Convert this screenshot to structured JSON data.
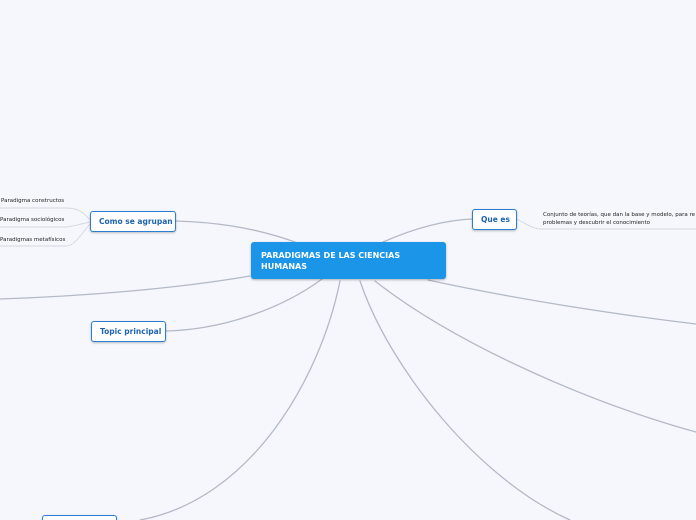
{
  "mindmap": {
    "central": {
      "line1": "PARADIGMAS DE LAS CIENCIAS",
      "line2": "HUMANAS"
    },
    "topics": {
      "como_se_agrupan": "Como se agrupan",
      "que_es": "Que es",
      "topic_principal": "Topic principal"
    },
    "subtopics": {
      "paradigma_constructos": "Paradigma constructos",
      "paradigma_sociologicos": "Paradigma sociológicos",
      "paradigmas_metafisicos": "Paradigmas metafísicos",
      "que_es_definicion_line1": "Conjunto de teorías,  que dan la base y modelo, para re",
      "que_es_definicion_line2": "problemas y descubrir el conocimiento"
    }
  },
  "colors": {
    "background": "#f5f7fd",
    "central_fill": "#1b95e8",
    "topic_border": "#2a7fd4",
    "topic_text": "#1d63b0",
    "connector": "#b4b9c6"
  }
}
